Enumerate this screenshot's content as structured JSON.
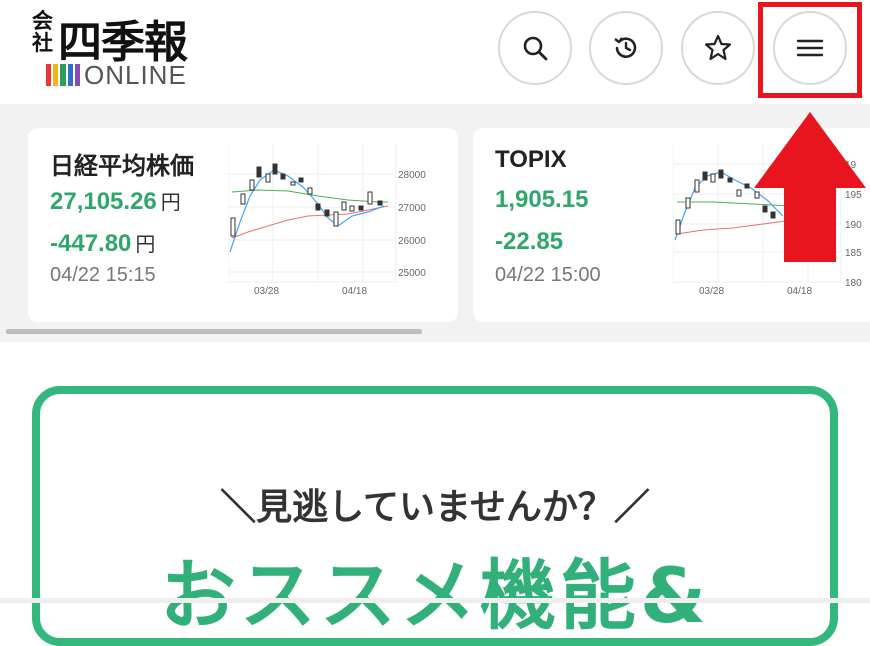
{
  "header": {
    "logo": {
      "company_mark": "会社",
      "title": "四季報",
      "sub": "ONLINE",
      "bar_colors": [
        "#e53935",
        "#f2b31b",
        "#2e9e5b",
        "#2f6fcf",
        "#8c4bb0"
      ]
    },
    "buttons": [
      {
        "name": "search",
        "icon": "search-icon"
      },
      {
        "name": "history",
        "icon": "history-icon"
      },
      {
        "name": "favorite",
        "icon": "star-icon"
      },
      {
        "name": "menu",
        "icon": "hamburger-menu-icon"
      }
    ]
  },
  "market": {
    "nikkei": {
      "name": "日経平均株価",
      "price": "27,105.26",
      "price_unit": "円",
      "change": "-447.80",
      "change_unit": "円",
      "time": "04/22 15:15",
      "y_ticks": [
        "28000",
        "27000",
        "26000",
        "25000"
      ],
      "x_ticks": [
        "03/28",
        "04/18"
      ]
    },
    "topix": {
      "name": "TOPIX",
      "price": "1,905.15",
      "change": "-22.85",
      "time": "04/22 15:00",
      "y_ticks": [
        "19",
        "195",
        "190",
        "185",
        "180"
      ],
      "x_ticks": [
        "03/28",
        "04/18"
      ]
    }
  },
  "promo": {
    "subheading": "＼見逃していませんか？／",
    "headline": "おススメ機能&"
  },
  "colors": {
    "accent_green": "#34b77c",
    "annotation_red": "#e8141e"
  }
}
